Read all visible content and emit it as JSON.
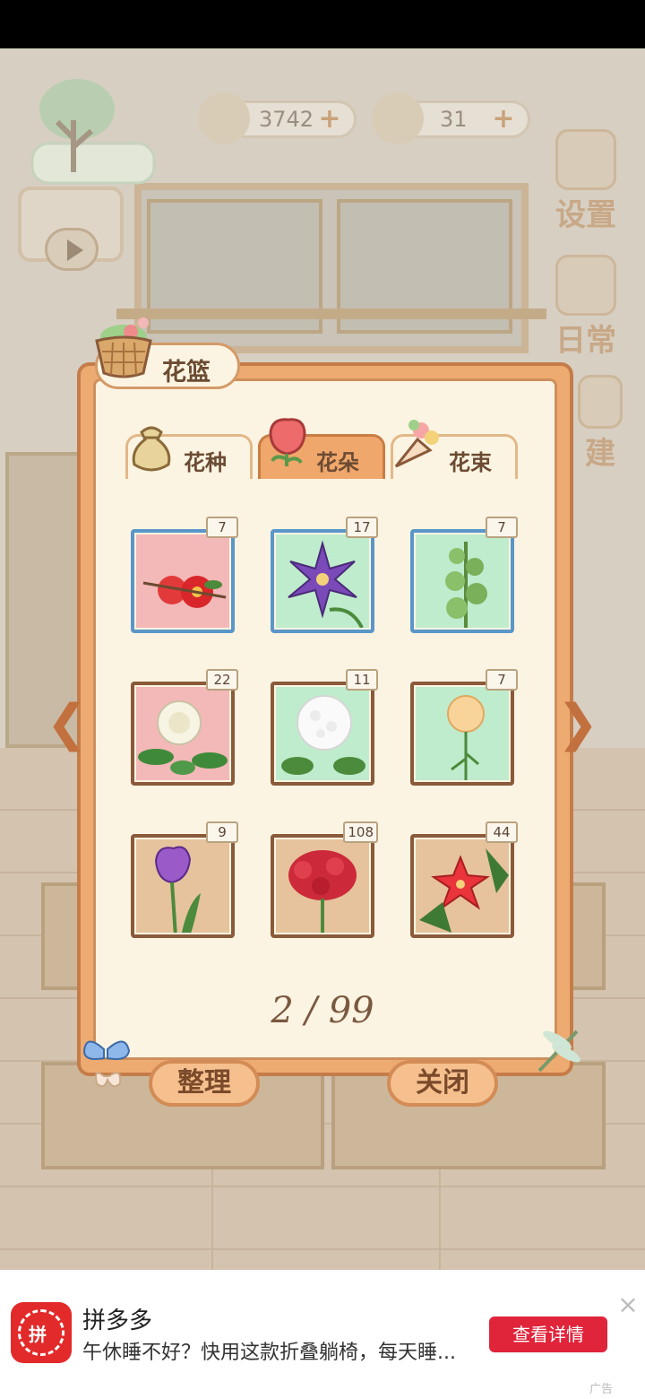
{
  "hud": {
    "fish_count": "3742",
    "cheese_count": "31",
    "settings_label": "设置",
    "daily_label": "日常",
    "build_label": "建",
    "plus": "+"
  },
  "modal": {
    "title": "花篮",
    "tabs": [
      {
        "label": "花种",
        "icon": "seed-bag-icon",
        "active": false
      },
      {
        "label": "花朵",
        "icon": "rose-icon",
        "active": true
      },
      {
        "label": "花束",
        "icon": "bouquet-icon",
        "active": false
      }
    ],
    "items": [
      {
        "count": "7",
        "bg": "#f3b8b8",
        "flower": "red-camellia",
        "frame": "blue"
      },
      {
        "count": "17",
        "bg": "#bfeccc",
        "flower": "purple-clematis",
        "frame": "blue"
      },
      {
        "count": "7",
        "bg": "#bfeccc",
        "flower": "bells-of-ireland",
        "frame": "blue"
      },
      {
        "count": "22",
        "bg": "#f3b8b8",
        "flower": "white-gardenia",
        "frame": "brown"
      },
      {
        "count": "11",
        "bg": "#bfeccc",
        "flower": "white-hydrangea",
        "frame": "brown"
      },
      {
        "count": "7",
        "bg": "#bfeccc",
        "flower": "peach-carnation",
        "frame": "brown"
      },
      {
        "count": "9",
        "bg": "#e6c39c",
        "flower": "purple-tulip",
        "frame": "brown"
      },
      {
        "count": "108",
        "bg": "#e6c39c",
        "flower": "red-celosia",
        "frame": "brown"
      },
      {
        "count": "44",
        "bg": "#e6c39c",
        "flower": "red-star-flower",
        "frame": "brown"
      }
    ],
    "page": "2 / 99",
    "sort_button": "整理",
    "close_button": "关闭"
  },
  "ad": {
    "title": "拼多多",
    "description": "午休睡不好？快用这款折叠躺椅，每天睡...",
    "cta": "查看详情",
    "tag": "广告",
    "logo_text": "拼",
    "close": "×"
  },
  "colors": {
    "modal_orange": "#eeab71",
    "panel_cream": "#fcf4e2",
    "ad_red": "#e0243a"
  }
}
